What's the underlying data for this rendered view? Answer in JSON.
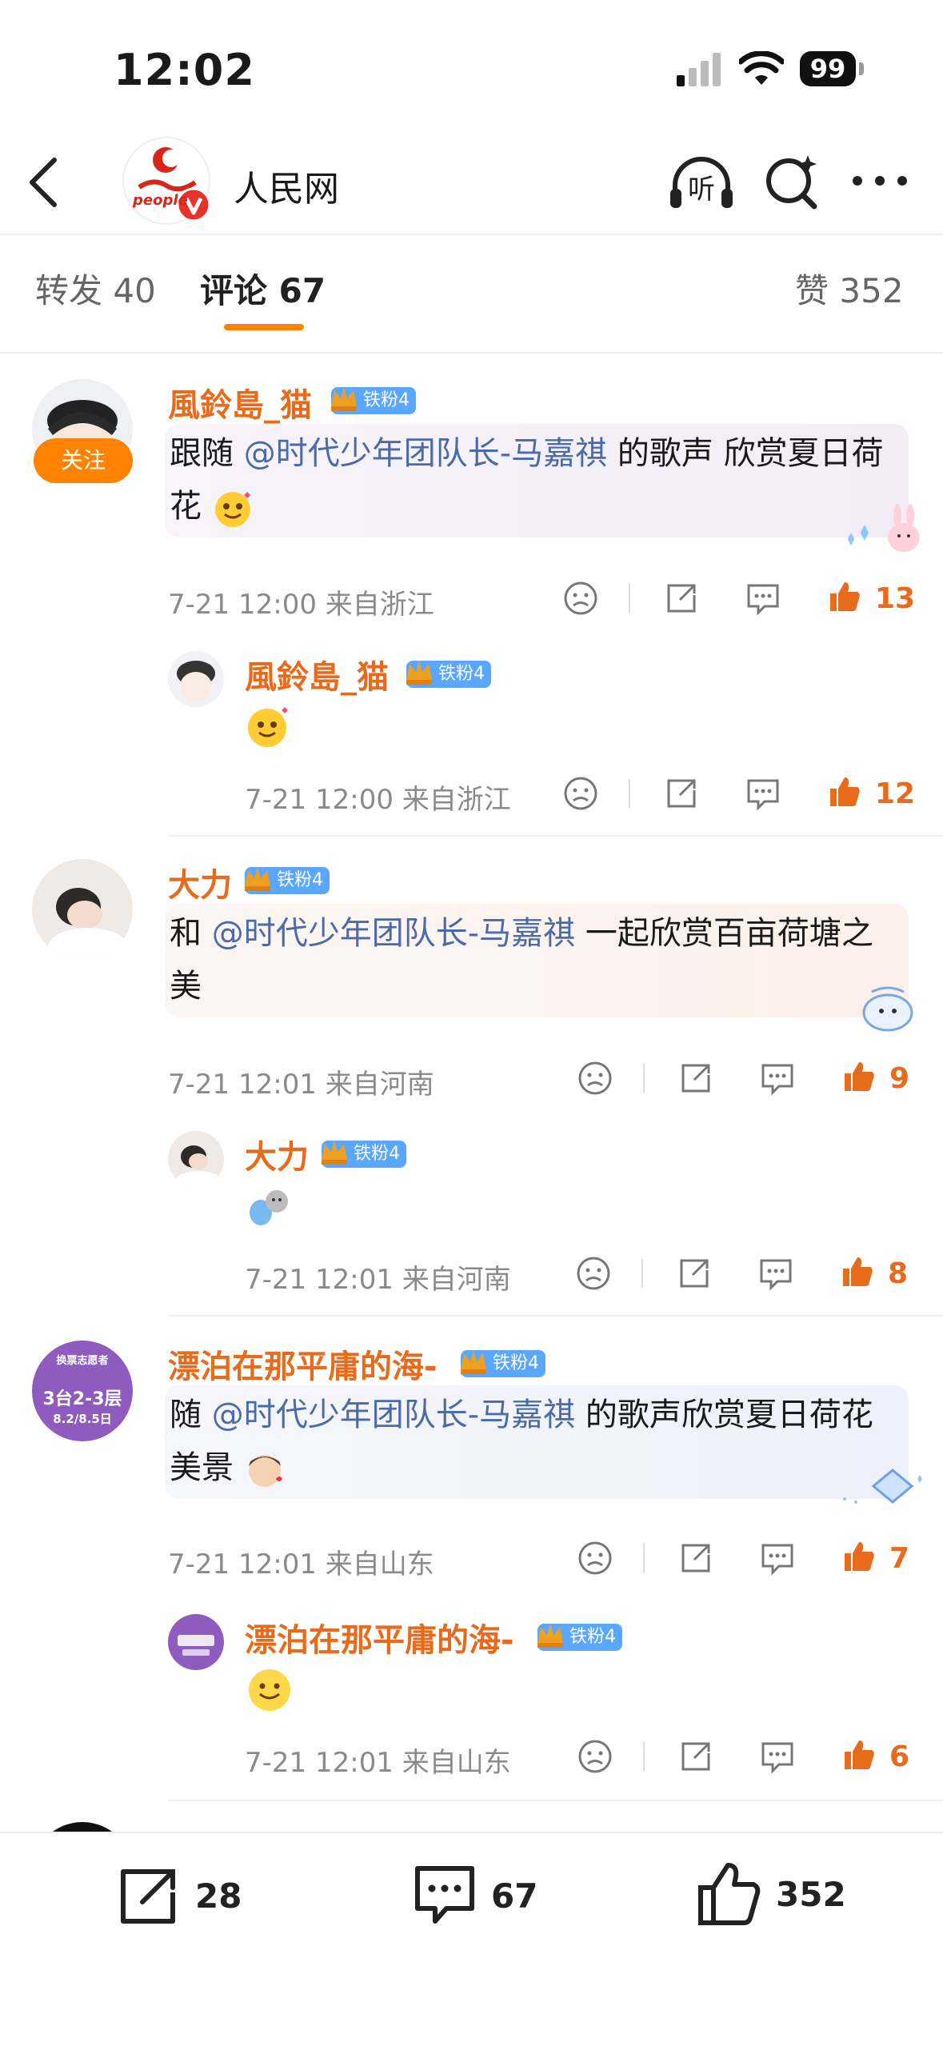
{
  "status_bar": {
    "time": "12:02",
    "battery": "99"
  },
  "header": {
    "account_name": "人民网",
    "logo_small_text": "people"
  },
  "tabs": [
    {
      "label": "转发",
      "count": "40"
    },
    {
      "label": "评论",
      "count": "67"
    },
    {
      "label": "赞",
      "count": "352"
    }
  ],
  "follow_label": "关注",
  "comments": [
    {
      "user": "風鈴島_猫",
      "badge": "铁粉4",
      "text_parts": [
        "跟随 ",
        "@时代少年团队长-马嘉祺",
        " 的歌声 欣赏夏日荷花"
      ],
      "meta": "7-21 12:00  来自浙江",
      "likes": "13",
      "reply": {
        "user": "風鈴島_猫",
        "badge": "铁粉4",
        "meta": "7-21 12:00  来自浙江",
        "likes": "12"
      }
    },
    {
      "user": "大力",
      "badge": "铁粉4",
      "text_parts": [
        "和 ",
        "@时代少年团队长-马嘉祺",
        " 一起欣赏百亩荷塘之美"
      ],
      "meta": "7-21 12:01  来自河南",
      "likes": "9",
      "reply": {
        "user": "大力",
        "badge": "铁粉4",
        "meta": "7-21 12:01  来自河南",
        "likes": "8"
      }
    },
    {
      "user": "漂泊在那平庸的海-",
      "badge": "铁粉4",
      "avatar_text": [
        "换票志愿者",
        "3台2-3层",
        "8.2/8.5日"
      ],
      "text_parts": [
        "随 ",
        "@时代少年团队长-马嘉祺",
        " 的歌声欣赏夏日荷花美景"
      ],
      "meta": "7-21 12:01  来自山东",
      "likes": "7",
      "reply": {
        "user": "漂泊在那平庸的海-",
        "badge": "铁粉4",
        "meta": "7-21 12:01  来自山东",
        "likes": "6"
      }
    }
  ],
  "bottom_bar": {
    "reposts": "28",
    "comments": "67",
    "likes": "352"
  },
  "colors": {
    "accent": "#ff8200",
    "username": "#e86b1c",
    "mention": "#4a6aa8",
    "badge": "#5aa7ff"
  }
}
